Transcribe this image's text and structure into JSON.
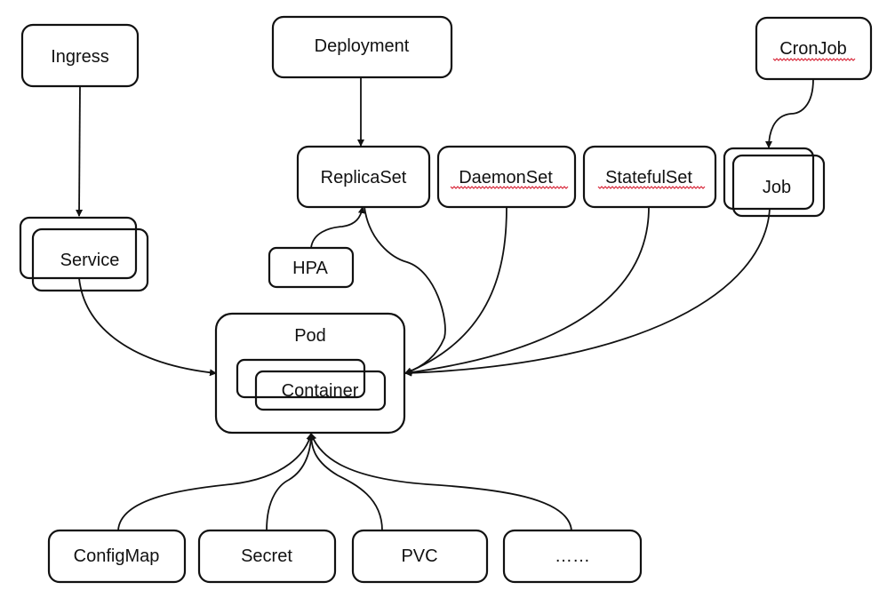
{
  "nodes": {
    "ingress": "Ingress",
    "deployment": "Deployment",
    "cronjob": "CronJob",
    "replicaset": "ReplicaSet",
    "daemonset": "DaemonSet",
    "statefulset": "StatefulSet",
    "job": "Job",
    "service": "Service",
    "hpa": "HPA",
    "pod": "Pod",
    "container": "Container",
    "configmap": "ConfigMap",
    "secret": "Secret",
    "pvc": "PVC",
    "more": "……"
  },
  "colors": {
    "stroke": "#111111",
    "spellcheck_underline": "#d8283a"
  }
}
